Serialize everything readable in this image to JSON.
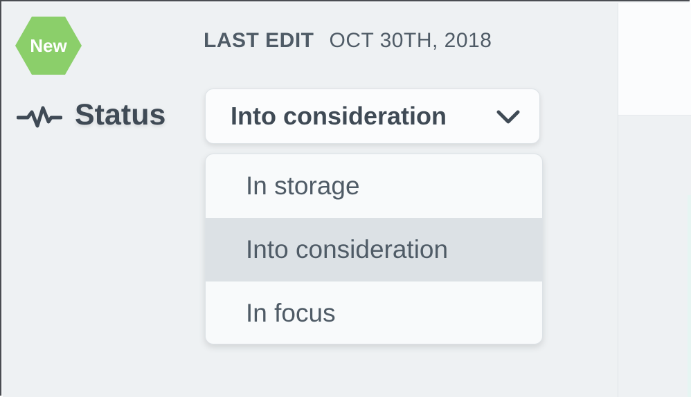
{
  "badge": {
    "label": "New",
    "color": "#8bcf6a"
  },
  "meta": {
    "last_edit_label": "LAST EDIT",
    "last_edit_date": "OCT 30TH, 2018"
  },
  "status": {
    "label": "Status",
    "icon": "activity-pulse-icon",
    "selected": "Into consideration",
    "chevron_icon": "chevron-down-icon",
    "options": [
      {
        "label": "In storage",
        "highlighted": false
      },
      {
        "label": "Into consideration",
        "highlighted": true
      },
      {
        "label": "In focus",
        "highlighted": false
      }
    ]
  },
  "colors": {
    "text_primary": "#3f4a55",
    "text_secondary": "#4f5b66",
    "highlight_row": "#dce1e5",
    "panel_bg": "#eef1f3"
  }
}
